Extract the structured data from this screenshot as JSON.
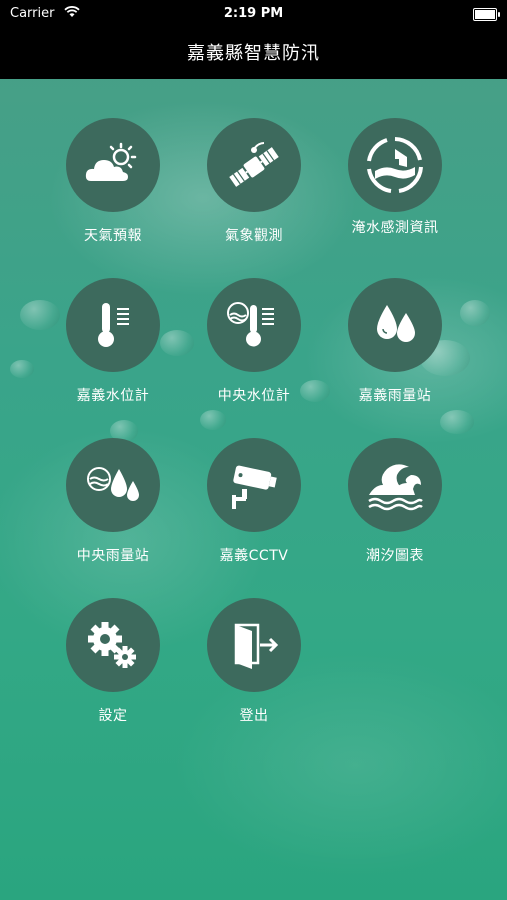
{
  "status_bar": {
    "carrier": "Carrier",
    "time": "2:19 PM",
    "battery_level": 1.0
  },
  "nav": {
    "title": "嘉義縣智慧防汛"
  },
  "menu": [
    {
      "label": "天氣預報",
      "icon": "weather-icon"
    },
    {
      "label": "氣象觀測",
      "icon": "satellite-icon"
    },
    {
      "label": "淹水感測資訊",
      "icon": "flood-sensor-icon"
    },
    {
      "label": "嘉義水位計",
      "icon": "thermometer-icon"
    },
    {
      "label": "中央水位計",
      "icon": "water-thermometer-icon"
    },
    {
      "label": "嘉義雨量站",
      "icon": "rain-drops-icon"
    },
    {
      "label": "中央雨量站",
      "icon": "water-rain-icon"
    },
    {
      "label": "嘉義CCTV",
      "icon": "cctv-icon"
    },
    {
      "label": "潮汐圖表",
      "icon": "wave-icon"
    },
    {
      "label": "設定",
      "icon": "gear-icon"
    },
    {
      "label": "登出",
      "icon": "logout-icon"
    }
  ]
}
